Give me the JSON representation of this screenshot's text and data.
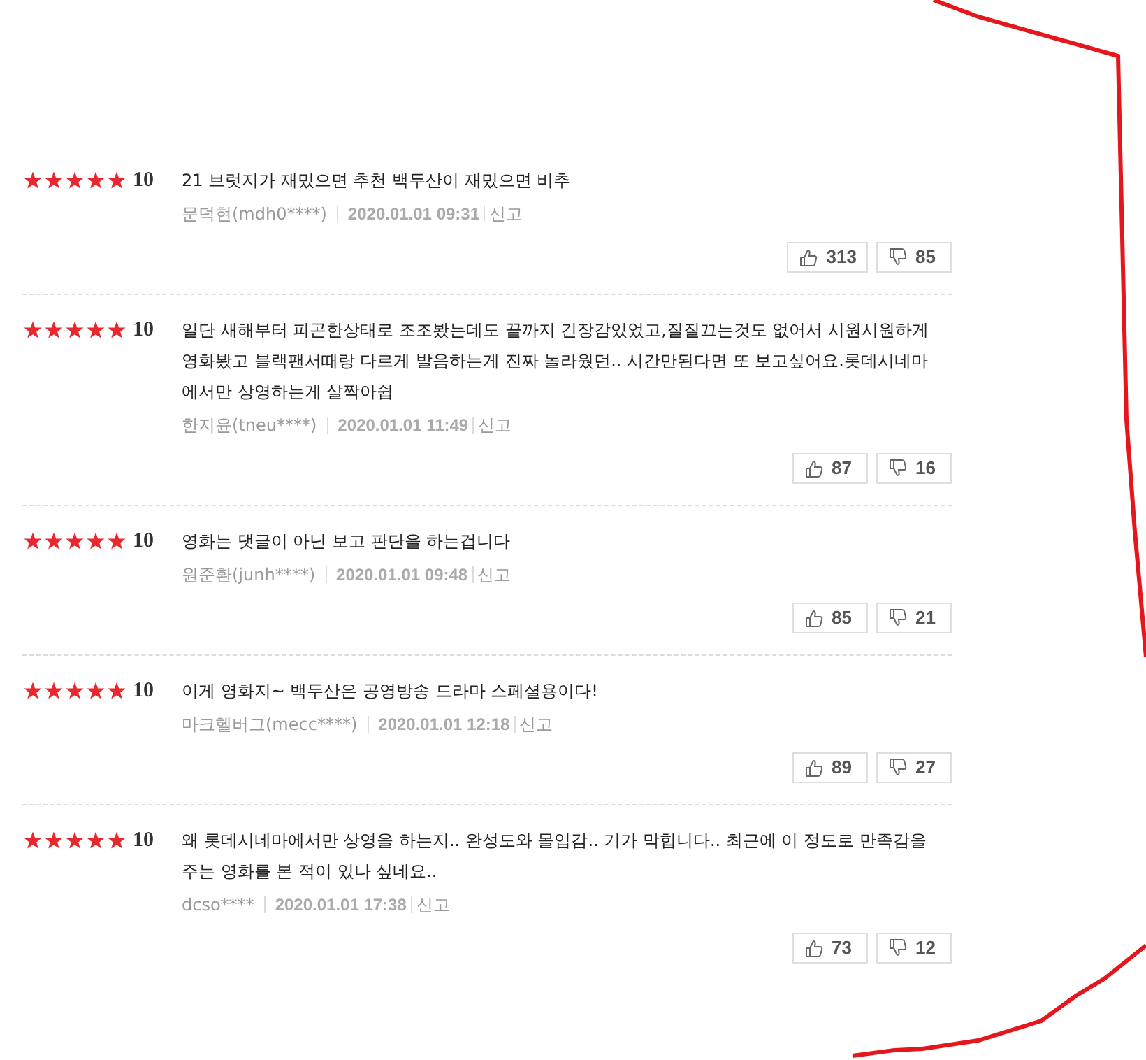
{
  "reviews": [
    {
      "stars": 5,
      "score": "10",
      "text": "21 브럿지가 재밌으면 추천 백두산이 재밌으면 비추",
      "author": "문덕현(mdh0****)",
      "date": "2020.01.01 09:31",
      "report": "신고",
      "likes": "313",
      "dislikes": "85"
    },
    {
      "stars": 5,
      "score": "10",
      "text": "일단 새해부터 피곤한상태로 조조봤는데도 끝까지 긴장감있었고,질질끄는것도 없어서 시원시원하게 영화봤고 블랙팬서때랑 다르게 발음하는게 진짜 놀라웠던.. 시간만된다면 또 보고싶어요.롯데시네마에서만 상영하는게 살짝아쉽",
      "author": "한지윤(tneu****)",
      "date": "2020.01.01 11:49",
      "report": "신고",
      "likes": "87",
      "dislikes": "16"
    },
    {
      "stars": 5,
      "score": "10",
      "text": "영화는 댓글이 아닌 보고 판단을 하는겁니다",
      "author": "원준환(junh****)",
      "date": "2020.01.01 09:48",
      "report": "신고",
      "likes": "85",
      "dislikes": "21"
    },
    {
      "stars": 5,
      "score": "10",
      "text": "이게 영화지~ 백두산은 공영방송 드라마 스페셜용이다!",
      "author": "마크헬버그(mecc****)",
      "date": "2020.01.01 12:18",
      "report": "신고",
      "likes": "89",
      "dislikes": "27"
    },
    {
      "stars": 5,
      "score": "10",
      "text": "왜 롯데시네마에서만 상영을 하는지.. 완성도와 몰입감.. 기가 막힙니다.. 최근에 이 정도로 만족감을 주는 영화를 본 적이 있나 싶네요..",
      "author": "dcso****",
      "date": "2020.01.01 17:38",
      "report": "신고",
      "likes": "73",
      "dislikes": "12"
    }
  ]
}
